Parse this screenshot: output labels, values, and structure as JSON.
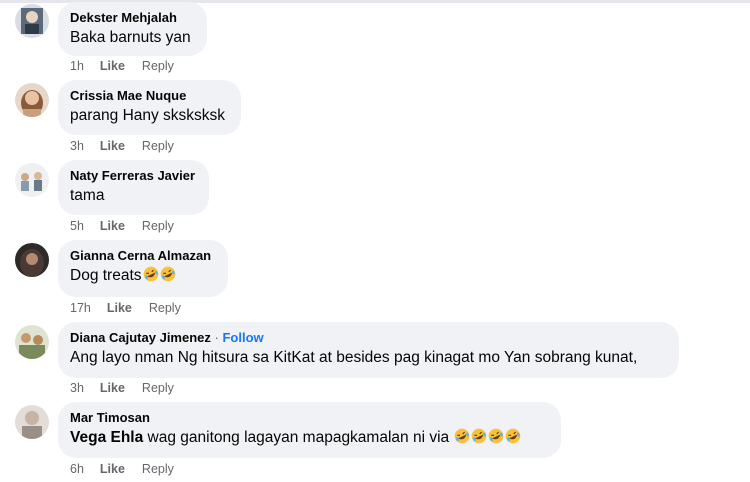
{
  "comments": [
    {
      "author": "Dekster Mehjalah",
      "text": "Baka barnuts yan",
      "time": "1h",
      "like": "Like",
      "reply": "Reply",
      "avatar_color": "#5b6b7c"
    },
    {
      "author": "Crissia Mae Nuque",
      "text": "parang Hany sksksksk",
      "time": "3h",
      "like": "Like",
      "reply": "Reply",
      "avatar_color": "#c9a07a"
    },
    {
      "author": "Naty Ferreras Javier",
      "text": "tama",
      "time": "5h",
      "like": "Like",
      "reply": "Reply",
      "avatar_color": "#8a9aa8"
    },
    {
      "author": "Gianna Cerna Almazan",
      "text": "Dog treats",
      "time": "17h",
      "like": "Like",
      "reply": "Reply",
      "avatar_color": "#4a3a35"
    },
    {
      "author": "Diana Cajutay Jimenez",
      "separator": "·",
      "follow": "Follow",
      "text": "Ang layo nman Ng hitsura sa KitKat at besides pag kinagat mo Yan sobrang kunat,",
      "time": "3h",
      "like": "Like",
      "reply": "Reply",
      "avatar_color": "#7a8a5a"
    },
    {
      "author": "Mar Timosan",
      "mention": "Vega Ehla",
      "text": "wag ganitong lagayan mapagkamalan ni via",
      "time": "6h",
      "like": "Like",
      "reply": "Reply",
      "avatar_color": "#9a8f86"
    }
  ],
  "emoji": {
    "name": "rolling-on-floor-laughing-emoji",
    "face": "#f7c13b",
    "mouth": "#6b3a1e"
  },
  "colors": {
    "bubble": "#f0f2f5",
    "muted": "#65676b",
    "follow": "#1877f2",
    "text": "#050505"
  }
}
